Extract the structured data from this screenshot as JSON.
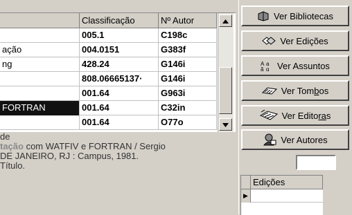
{
  "grid": {
    "columns": [
      "",
      "Classificação",
      "Nº Autor"
    ],
    "rows": [
      {
        "title": "",
        "classificacao": "005.1",
        "autor": "C198c"
      },
      {
        "title": "ação",
        "classificacao": "004.0151",
        "autor": "G383f"
      },
      {
        "title": "ng",
        "classificacao": "428.24",
        "autor": "G146i"
      },
      {
        "title": "",
        "classificacao": "808.06665137·",
        "autor": "G146i"
      },
      {
        "title": "",
        "classificacao": "001.64",
        "autor": "G963i"
      },
      {
        "title": "FORTRAN",
        "classificacao": "001.64",
        "autor": "C32in"
      },
      {
        "title": "",
        "classificacao": "001.64",
        "autor": "O77o"
      }
    ],
    "scroll_up_icon": "triangle-up",
    "scroll_down_icon": "triangle-down"
  },
  "detail": {
    "line1": "de",
    "line2_highlight": "tação",
    "line2_rest": " com WATFIV e FORTRAN / Sergio",
    "line3": "DE JANEIRO, RJ : Campus, 1981.",
    "line4": "Título."
  },
  "buttons": [
    {
      "pre": "Ver Bibliotecas",
      "ul": "",
      "post": "",
      "icon": "library-icon"
    },
    {
      "pre": "Ver Edições",
      "ul": "",
      "post": "",
      "icon": "editions-icon"
    },
    {
      "pre": "Ver Assuntos",
      "ul": "",
      "post": "",
      "icon": "subjects-icon"
    },
    {
      "pre": "Ver Tom",
      "ul": "b",
      "post": "os",
      "icon": "tombos-icon"
    },
    {
      "pre": "Ver Edito",
      "ul": "ra",
      "post": "s",
      "icon": "publishers-icon"
    },
    {
      "pre": "Ver Autores",
      "ul": "",
      "post": "",
      "icon": "authors-icon"
    }
  ],
  "editions": {
    "header": "Edições",
    "indicator": "▶"
  }
}
